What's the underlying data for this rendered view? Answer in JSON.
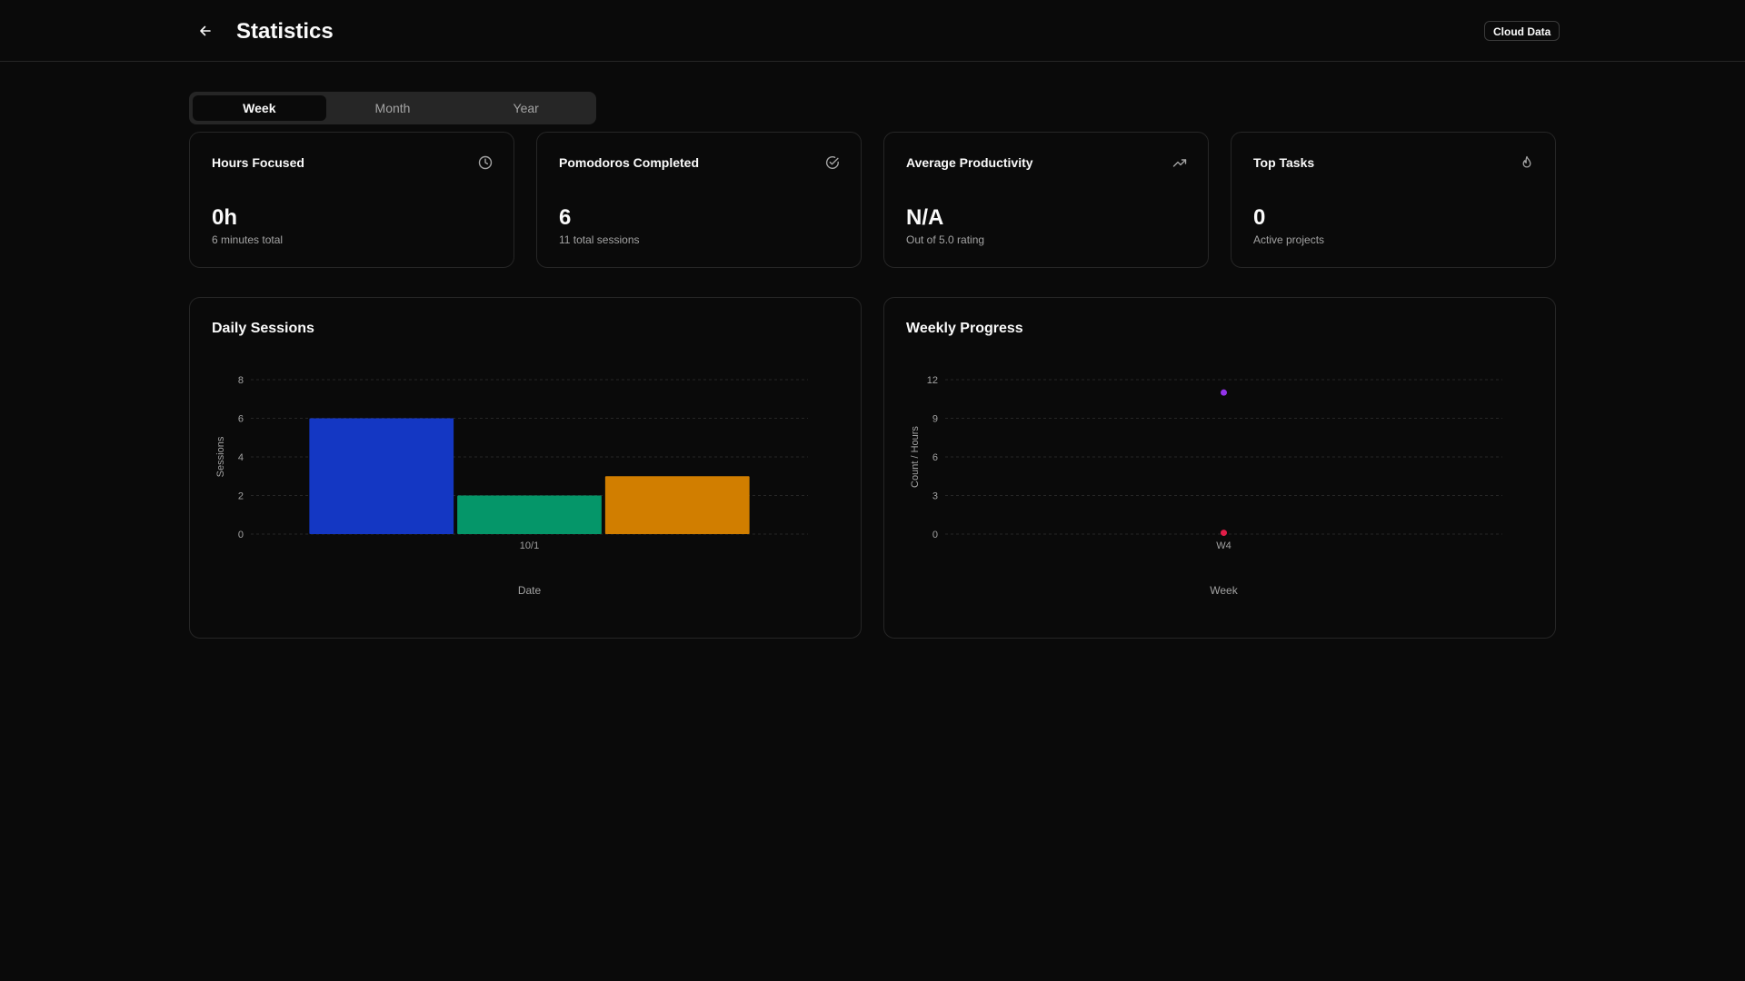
{
  "header": {
    "title": "Statistics",
    "cloud_button": "Cloud Data"
  },
  "tabs": [
    {
      "label": "Week",
      "active": true
    },
    {
      "label": "Month",
      "active": false
    },
    {
      "label": "Year",
      "active": false
    }
  ],
  "stats": [
    {
      "title": "Hours Focused",
      "value": "0h",
      "sub": "6 minutes total",
      "icon": "clock-icon"
    },
    {
      "title": "Pomodoros Completed",
      "value": "6",
      "sub": "11 total sessions",
      "icon": "check-circle-icon"
    },
    {
      "title": "Average Productivity",
      "value": "N/A",
      "sub": "Out of 5.0 rating",
      "icon": "trending-up-icon"
    },
    {
      "title": "Top Tasks",
      "value": "0",
      "sub": "Active projects",
      "icon": "flame-icon"
    }
  ],
  "chart_data": [
    {
      "type": "bar",
      "title": "Daily Sessions",
      "xlabel": "Date",
      "ylabel": "Sessions",
      "categories": [
        "10/1"
      ],
      "series": [
        {
          "values": [
            6
          ],
          "color": "#1437c3"
        },
        {
          "values": [
            2
          ],
          "color": "#059669"
        },
        {
          "values": [
            3
          ],
          "color": "#d17e00"
        }
      ],
      "ylim": [
        0,
        8
      ],
      "yticks": [
        0,
        2,
        4,
        6,
        8
      ],
      "grid": true
    },
    {
      "type": "scatter",
      "title": "Weekly Progress",
      "xlabel": "Week",
      "ylabel": "Count / Hours",
      "categories": [
        "W4"
      ],
      "series": [
        {
          "values": [
            11
          ],
          "color": "#9333ea"
        },
        {
          "values": [
            0.1
          ],
          "color": "#e11d48"
        }
      ],
      "ylim": [
        0,
        12
      ],
      "yticks": [
        0,
        3,
        6,
        9,
        12
      ],
      "grid": true
    }
  ]
}
